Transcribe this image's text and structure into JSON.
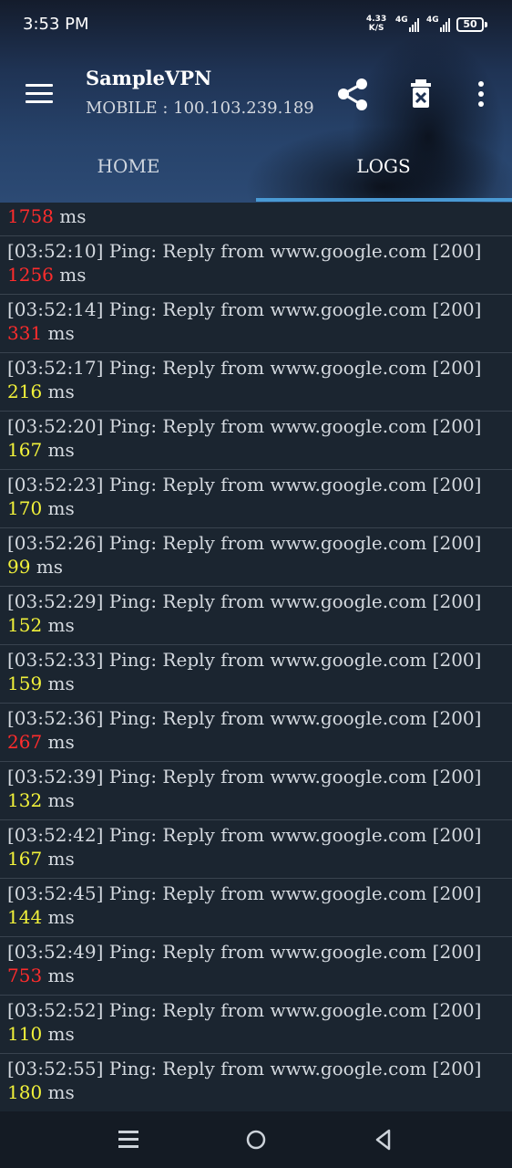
{
  "status_bar": {
    "time": "3:53 PM",
    "net_speed_value": "4.33",
    "net_speed_unit": "K/S",
    "network_1": "4G",
    "network_2": "4G",
    "battery": "50"
  },
  "toolbar": {
    "title": "SampleVPN",
    "subtitle": "MOBILE : 100.103.239.189",
    "menu_icon": "hamburger-menu-icon",
    "share_icon": "share-icon",
    "delete_icon": "delete-log-icon",
    "overflow_icon": "more-vertical-icon"
  },
  "tabs": [
    {
      "label": "HOME",
      "active": false
    },
    {
      "label": "LOGS",
      "active": true
    }
  ],
  "logs": [
    {
      "text": "",
      "ms": "1758",
      "level": "red"
    },
    {
      "text": "[03:52:10] Ping: Reply from www.google.com [200]",
      "ms": "1256",
      "level": "red"
    },
    {
      "text": "[03:52:14] Ping: Reply from www.google.com [200]",
      "ms": "331",
      "level": "red"
    },
    {
      "text": "[03:52:17] Ping: Reply from www.google.com [200]",
      "ms": "216",
      "level": "yellow"
    },
    {
      "text": "[03:52:20] Ping: Reply from www.google.com [200]",
      "ms": "167",
      "level": "yellow"
    },
    {
      "text": "[03:52:23] Ping: Reply from www.google.com [200]",
      "ms": "170",
      "level": "yellow"
    },
    {
      "text": "[03:52:26] Ping: Reply from www.google.com [200]",
      "ms": "99",
      "level": "yellow"
    },
    {
      "text": "[03:52:29] Ping: Reply from www.google.com [200]",
      "ms": "152",
      "level": "yellow"
    },
    {
      "text": "[03:52:33] Ping: Reply from www.google.com [200]",
      "ms": "159",
      "level": "yellow"
    },
    {
      "text": "[03:52:36] Ping: Reply from www.google.com [200]",
      "ms": "267",
      "level": "red"
    },
    {
      "text": "[03:52:39] Ping: Reply from www.google.com [200]",
      "ms": "132",
      "level": "yellow"
    },
    {
      "text": "[03:52:42] Ping: Reply from www.google.com [200]",
      "ms": "167",
      "level": "yellow"
    },
    {
      "text": "[03:52:45] Ping: Reply from www.google.com [200]",
      "ms": "144",
      "level": "yellow"
    },
    {
      "text": "[03:52:49] Ping: Reply from www.google.com [200]",
      "ms": "753",
      "level": "red"
    },
    {
      "text": "[03:52:52] Ping: Reply from www.google.com [200]",
      "ms": "110",
      "level": "yellow"
    },
    {
      "text": "[03:52:55] Ping: Reply from www.google.com [200]",
      "ms": "180",
      "level": "yellow"
    }
  ],
  "ms_unit": "ms",
  "colors": {
    "accent": "#4a9ad4",
    "ms_high": "#ff2c2c",
    "ms_normal": "#f2f23a",
    "background": "#1b2530"
  },
  "nav_bar": {
    "recents_icon": "recents-icon",
    "home_icon": "home-circle-icon",
    "back_icon": "back-triangle-icon"
  }
}
